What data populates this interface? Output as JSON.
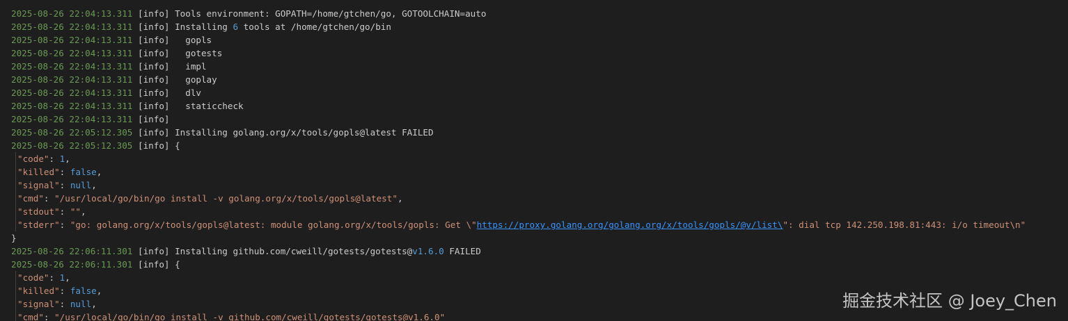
{
  "colors": {
    "background": "#1e1e1e",
    "text": "#cccccc",
    "timestamp": "#6a9955",
    "number": "#569cd6",
    "string": "#ce9178",
    "link": "#3794ff"
  },
  "lines": [
    {
      "kind": "log",
      "ts": "2025-08-26 22:04:13.311",
      "level": "[info]",
      "segs": [
        {
          "c": "txt",
          "t": " Tools environment: GOPATH=/home/gtchen/go, GOTOOLCHAIN=auto"
        }
      ]
    },
    {
      "kind": "log",
      "ts": "2025-08-26 22:04:13.311",
      "level": "[info]",
      "segs": [
        {
          "c": "txt",
          "t": " Installing "
        },
        {
          "c": "num",
          "t": "6"
        },
        {
          "c": "txt",
          "t": " tools at /home/gtchen/go/bin"
        }
      ]
    },
    {
      "kind": "log",
      "ts": "2025-08-26 22:04:13.311",
      "level": "[info]",
      "segs": [
        {
          "c": "txt",
          "t": "   gopls"
        }
      ]
    },
    {
      "kind": "log",
      "ts": "2025-08-26 22:04:13.311",
      "level": "[info]",
      "segs": [
        {
          "c": "txt",
          "t": "   gotests"
        }
      ]
    },
    {
      "kind": "log",
      "ts": "2025-08-26 22:04:13.311",
      "level": "[info]",
      "segs": [
        {
          "c": "txt",
          "t": "   impl"
        }
      ]
    },
    {
      "kind": "log",
      "ts": "2025-08-26 22:04:13.311",
      "level": "[info]",
      "segs": [
        {
          "c": "txt",
          "t": "   goplay"
        }
      ]
    },
    {
      "kind": "log",
      "ts": "2025-08-26 22:04:13.311",
      "level": "[info]",
      "segs": [
        {
          "c": "txt",
          "t": "   dlv"
        }
      ]
    },
    {
      "kind": "log",
      "ts": "2025-08-26 22:04:13.311",
      "level": "[info]",
      "segs": [
        {
          "c": "txt",
          "t": "   staticcheck"
        }
      ]
    },
    {
      "kind": "log",
      "ts": "2025-08-26 22:04:13.311",
      "level": "[info]",
      "segs": []
    },
    {
      "kind": "log",
      "ts": "2025-08-26 22:05:12.305",
      "level": "[info]",
      "segs": [
        {
          "c": "txt",
          "t": " Installing golang.org/x/tools/gopls@latest FAILED"
        }
      ]
    },
    {
      "kind": "log",
      "ts": "2025-08-26 22:05:12.305",
      "level": "[info]",
      "segs": [
        {
          "c": "txt",
          "t": " {"
        }
      ]
    },
    {
      "kind": "json",
      "segs": [
        {
          "c": "key",
          "t": "\"code\""
        },
        {
          "c": "txt",
          "t": ": "
        },
        {
          "c": "num",
          "t": "1"
        },
        {
          "c": "txt",
          "t": ","
        }
      ]
    },
    {
      "kind": "json",
      "segs": [
        {
          "c": "key",
          "t": "\"killed\""
        },
        {
          "c": "txt",
          "t": ": "
        },
        {
          "c": "kw",
          "t": "false"
        },
        {
          "c": "txt",
          "t": ","
        }
      ]
    },
    {
      "kind": "json",
      "segs": [
        {
          "c": "key",
          "t": "\"signal\""
        },
        {
          "c": "txt",
          "t": ": "
        },
        {
          "c": "kw",
          "t": "null"
        },
        {
          "c": "txt",
          "t": ","
        }
      ]
    },
    {
      "kind": "json",
      "segs": [
        {
          "c": "key",
          "t": "\"cmd\""
        },
        {
          "c": "txt",
          "t": ": "
        },
        {
          "c": "str",
          "t": "\"/usr/local/go/bin/go install -v golang.org/x/tools/gopls@latest\""
        },
        {
          "c": "txt",
          "t": ","
        }
      ]
    },
    {
      "kind": "json",
      "segs": [
        {
          "c": "key",
          "t": "\"stdout\""
        },
        {
          "c": "txt",
          "t": ": "
        },
        {
          "c": "str",
          "t": "\"\""
        },
        {
          "c": "txt",
          "t": ","
        }
      ]
    },
    {
      "kind": "json",
      "segs": [
        {
          "c": "key",
          "t": "\"stderr\""
        },
        {
          "c": "txt",
          "t": ": "
        },
        {
          "c": "str",
          "t": "\"go: golang.org/x/tools/gopls@latest: module golang.org/x/tools/gopls: Get \\\""
        },
        {
          "c": "lnk",
          "t": "https://proxy.golang.org/golang.org/x/tools/gopls/@v/list\\"
        },
        {
          "c": "str",
          "t": "\": dial tcp 142.250.198.81:443: i/o timeout\\n\""
        }
      ]
    },
    {
      "kind": "plain",
      "segs": [
        {
          "c": "txt",
          "t": "}"
        }
      ]
    },
    {
      "kind": "log",
      "ts": "2025-08-26 22:06:11.301",
      "level": "[info]",
      "segs": [
        {
          "c": "txt",
          "t": " Installing github.com/cweill/gotests/gotests@"
        },
        {
          "c": "num",
          "t": "v1.6.0"
        },
        {
          "c": "txt",
          "t": " FAILED"
        }
      ]
    },
    {
      "kind": "log",
      "ts": "2025-08-26 22:06:11.301",
      "level": "[info]",
      "segs": [
        {
          "c": "txt",
          "t": " {"
        }
      ]
    },
    {
      "kind": "json",
      "segs": [
        {
          "c": "key",
          "t": "\"code\""
        },
        {
          "c": "txt",
          "t": ": "
        },
        {
          "c": "num",
          "t": "1"
        },
        {
          "c": "txt",
          "t": ","
        }
      ]
    },
    {
      "kind": "json",
      "segs": [
        {
          "c": "key",
          "t": "\"killed\""
        },
        {
          "c": "txt",
          "t": ": "
        },
        {
          "c": "kw",
          "t": "false"
        },
        {
          "c": "txt",
          "t": ","
        }
      ]
    },
    {
      "kind": "json",
      "segs": [
        {
          "c": "key",
          "t": "\"signal\""
        },
        {
          "c": "txt",
          "t": ": "
        },
        {
          "c": "kw",
          "t": "null"
        },
        {
          "c": "txt",
          "t": ","
        }
      ]
    },
    {
      "kind": "json",
      "segs": [
        {
          "c": "key",
          "t": "\"cmd\""
        },
        {
          "c": "txt",
          "t": ": "
        },
        {
          "c": "str",
          "t": "\"/usr/local/go/bin/go install -v github.com/cweill/gotests/gotests@v1.6.0\""
        }
      ]
    }
  ],
  "watermark": "掘金技术社区 @ Joey_Chen"
}
